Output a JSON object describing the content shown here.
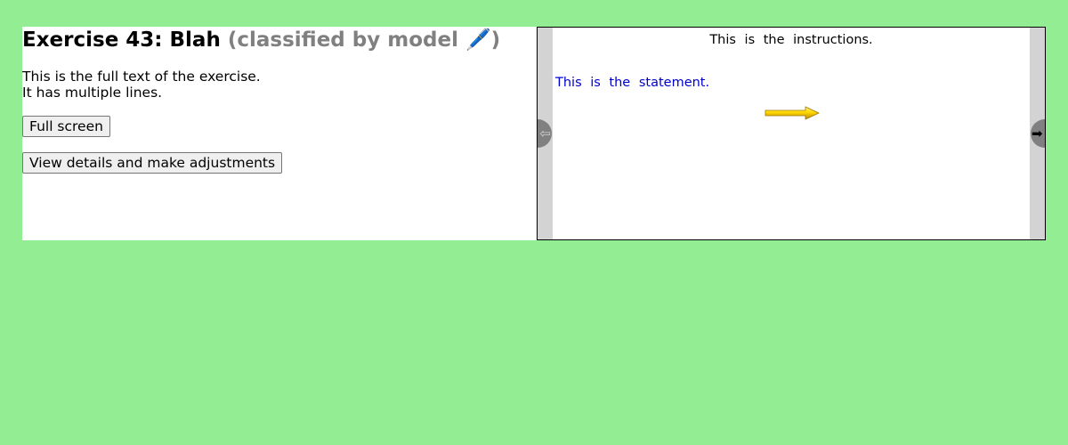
{
  "exercise": {
    "title": "Exercise 43: Blah",
    "classification": "(classified by model 🖊️)",
    "text_lines": [
      "This is the full text of the exercise.",
      "It has multiple lines."
    ]
  },
  "buttons": {
    "fullscreen_label": "Full screen",
    "details_label": "View details and make adjustments"
  },
  "preview": {
    "instructions": "This is the instructions.",
    "statement": "This is the statement.",
    "prev_icon": "arrow-left-icon",
    "next_icon": "arrow-right-icon",
    "prev_glyph": "⇦",
    "next_glyph": "➡",
    "arrow_icon": "yellow-arrow-icon"
  },
  "colors": {
    "page_background": "#93ee93",
    "statement_text": "#0000cd",
    "classification_text": "#808080",
    "arrow_fill": "#ffd700"
  }
}
